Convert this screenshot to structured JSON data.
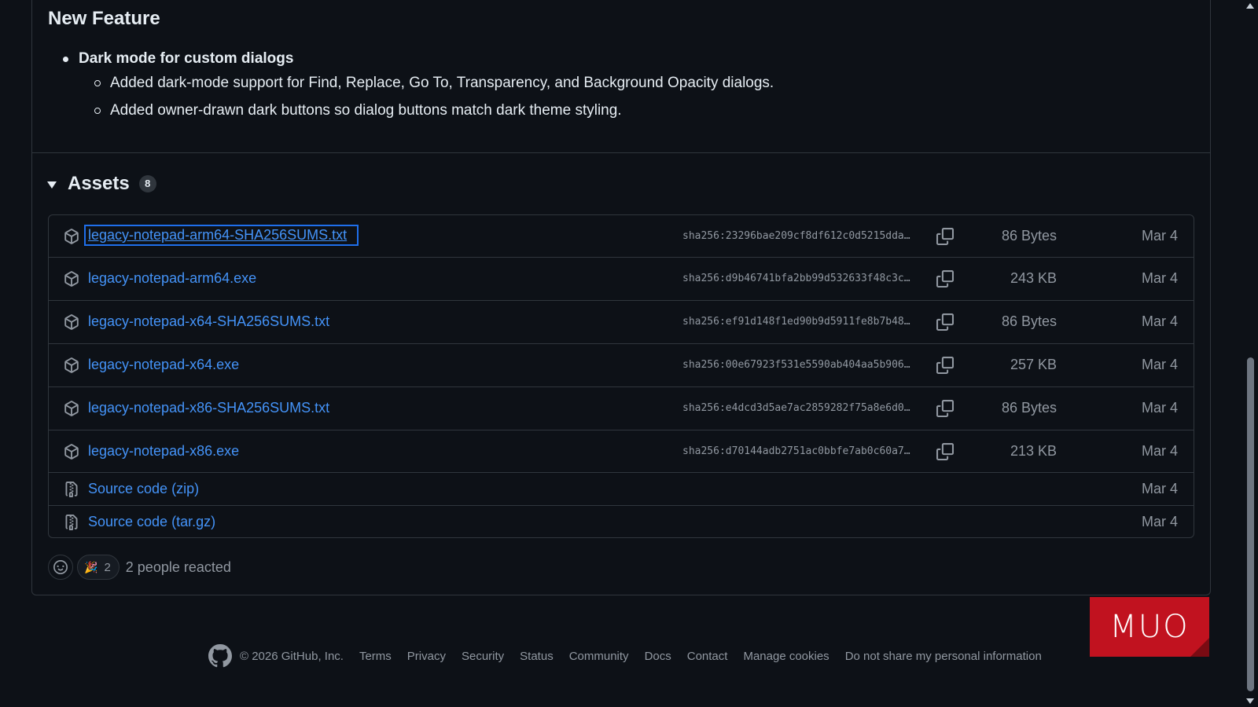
{
  "release": {
    "section_heading": "New Feature",
    "feature": {
      "title": "Dark mode for custom dialogs",
      "details": [
        "Added dark-mode support for Find, Replace, Go To, Transparency, and Background Opacity dialogs.",
        "Added owner-drawn dark buttons so dialog buttons match dark theme styling."
      ]
    }
  },
  "assets": {
    "title": "Assets",
    "count": "8",
    "files": [
      {
        "name": "legacy-notepad-arm64-SHA256SUMS.txt",
        "sha": "sha256:23296bae209cf8df612c0d5215dda…",
        "size": "86 Bytes",
        "date": "Mar 4",
        "icon": "package-icon"
      },
      {
        "name": "legacy-notepad-arm64.exe",
        "sha": "sha256:d9b46741bfa2bb99d532633f48c3c…",
        "size": "243 KB",
        "date": "Mar 4",
        "icon": "package-icon"
      },
      {
        "name": "legacy-notepad-x64-SHA256SUMS.txt",
        "sha": "sha256:ef91d148f1ed90b9d5911fe8b7b48…",
        "size": "86 Bytes",
        "date": "Mar 4",
        "icon": "package-icon"
      },
      {
        "name": "legacy-notepad-x64.exe",
        "sha": "sha256:00e67923f531e5590ab404aa5b906…",
        "size": "257 KB",
        "date": "Mar 4",
        "icon": "package-icon"
      },
      {
        "name": "legacy-notepad-x86-SHA256SUMS.txt",
        "sha": "sha256:e4dcd3d5ae7ac2859282f75a8e6d0…",
        "size": "86 Bytes",
        "date": "Mar 4",
        "icon": "package-icon"
      },
      {
        "name": "legacy-notepad-x86.exe",
        "sha": "sha256:d70144adb2751ac0bbfe7ab0c60a7…",
        "size": "213 KB",
        "date": "Mar 4",
        "icon": "package-icon"
      }
    ],
    "source": [
      {
        "label": "Source code",
        "format": "(zip)",
        "date": "Mar 4",
        "icon": "file-zip-icon"
      },
      {
        "label": "Source code",
        "format": "(tar.gz)",
        "date": "Mar 4",
        "icon": "file-zip-icon"
      }
    ]
  },
  "reactions": {
    "emoji": "🎉",
    "count": "2",
    "summary": "2 people reacted"
  },
  "footer": {
    "copyright": "© 2026 GitHub, Inc.",
    "links": [
      "Terms",
      "Privacy",
      "Security",
      "Status",
      "Community",
      "Docs",
      "Contact",
      "Manage cookies",
      "Do not share my personal information"
    ]
  },
  "watermark": {
    "text": "MUO",
    "color": "#c1121f"
  },
  "colors": {
    "background": "#0d1117",
    "link": "#4493f8",
    "muted": "#9198a1",
    "border": "#30363d"
  }
}
